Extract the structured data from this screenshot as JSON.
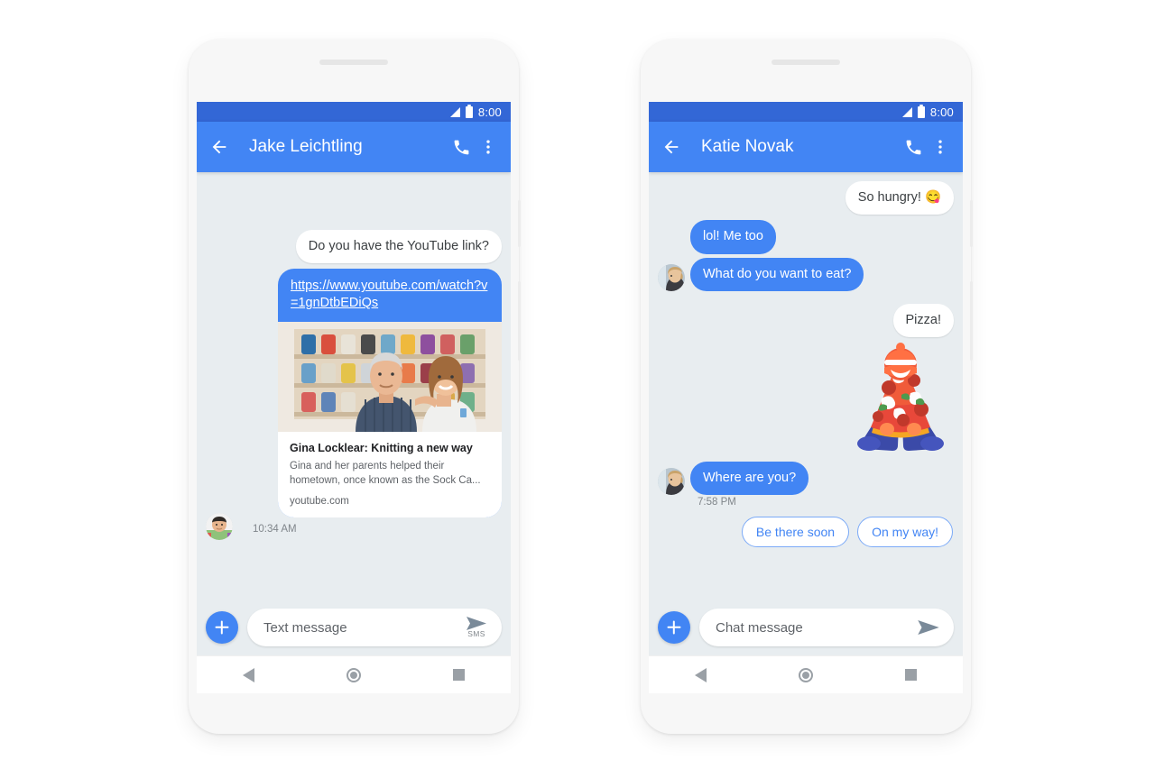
{
  "phones": [
    {
      "id": "sms-thread",
      "statusbar": {
        "time": "8:00",
        "signal_icon": "signal-icon",
        "battery_icon": "battery-icon"
      },
      "appbar": {
        "back_icon": "arrow-back-icon",
        "title": "Jake Leichtling",
        "call_icon": "phone-call-icon",
        "overflow_icon": "more-vert-icon"
      },
      "messages": [
        {
          "kind": "text",
          "side": "out",
          "style": "white",
          "text": "Do you have the YouTube link?"
        },
        {
          "kind": "link-card",
          "side": "out",
          "url": "https://www.youtube.com/watch?v=1gnDtbEDiQs",
          "card_title": "Gina Locklear: Knitting a new way",
          "card_desc": "Gina and her parents helped their hometown, once known as the Sock Ca...",
          "card_domain": "youtube.com",
          "thumb_alt": "two-people-in-front-of-sock-display"
        }
      ],
      "timestamp": "10:34 AM",
      "avatar_alt": "jake-avatar",
      "compose": {
        "plus_icon": "add-attachment-icon",
        "placeholder": "Text message",
        "value": "",
        "send_icon": "send-icon",
        "send_label": "SMS"
      },
      "nav": {
        "back": "nav-back-icon",
        "home": "nav-home-icon",
        "recents": "nav-recents-icon"
      }
    },
    {
      "id": "chat-thread",
      "statusbar": {
        "time": "8:00",
        "signal_icon": "signal-icon",
        "battery_icon": "battery-icon"
      },
      "appbar": {
        "back_icon": "arrow-back-icon",
        "title": "Katie Novak",
        "call_icon": "phone-call-icon",
        "overflow_icon": "more-vert-icon"
      },
      "messages": [
        {
          "kind": "text",
          "side": "out",
          "style": "white",
          "text": "So hungry! 😋"
        },
        {
          "kind": "text",
          "side": "in",
          "style": "blue",
          "text": "lol! Me too"
        },
        {
          "kind": "text",
          "side": "in",
          "style": "blue",
          "text": "What do you want to eat?",
          "avatar": true
        },
        {
          "kind": "text",
          "side": "out",
          "style": "white",
          "text": "Pizza!"
        },
        {
          "kind": "sticker",
          "side": "out",
          "sticker_alt": "pizza-character-sticker"
        },
        {
          "kind": "text",
          "side": "in",
          "style": "blue",
          "text": "Where are you?",
          "avatar": true
        }
      ],
      "timestamp": "7:58 PM",
      "avatar_alt": "katie-avatar",
      "smart_replies": [
        "Be there soon",
        "On my way!"
      ],
      "compose": {
        "plus_icon": "add-attachment-icon",
        "placeholder": "Chat message",
        "value": "",
        "send_icon": "send-icon",
        "send_label": ""
      },
      "nav": {
        "back": "nav-back-icon",
        "home": "nav-home-icon",
        "recents": "nav-recents-icon"
      }
    }
  ],
  "colors": {
    "brand_blue": "#4285f4",
    "status_blue": "#3367d6",
    "chat_background": "#e8edf0",
    "chip_border": "#7baaf7",
    "page_background": "#ffffff"
  }
}
